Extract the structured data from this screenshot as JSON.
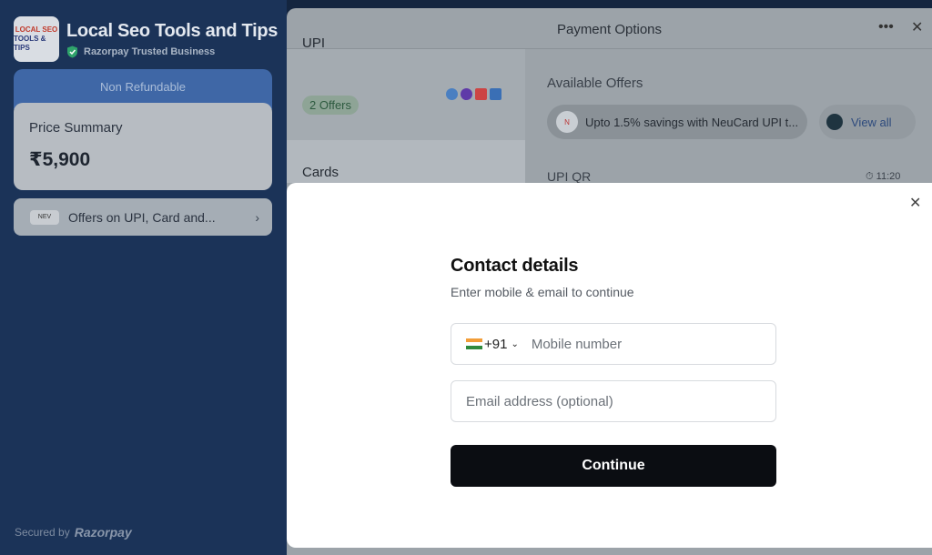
{
  "merchant": {
    "name": "Local Seo Tools and Tips",
    "logo_line1": "LOCAL SEO",
    "logo_line2": "TOOLS & TIPS",
    "trusted_label": "Razorpay Trusted Business"
  },
  "summary": {
    "refund_label": "Non Refundable",
    "price_label": "Price Summary",
    "price_value": "₹5,900",
    "offers_badge": "NEV",
    "offers_text": "Offers on UPI, Card and..."
  },
  "footer": {
    "secured_text": "Secured by",
    "brand": "Razorpay"
  },
  "payment": {
    "title": "Payment Options",
    "methods": [
      {
        "label": "UPI",
        "badge": "2 Offers"
      },
      {
        "label": "Cards"
      }
    ],
    "offers_title": "Available Offers",
    "offer_text": "Upto 1.5% savings with NeuCard UPI t...",
    "view_all": "View all",
    "upi_qr": "UPI QR",
    "timer": "11:20"
  },
  "modal": {
    "title": "Contact details",
    "subtitle": "Enter mobile & email to continue",
    "country_code": "+91",
    "mobile_placeholder": "Mobile number",
    "email_placeholder": "Email address (optional)",
    "continue_label": "Continue"
  },
  "colors": {
    "primary_button": "#0b0d12",
    "accent_blue": "#3f67a6",
    "offer_green": "#2d5a3f"
  }
}
